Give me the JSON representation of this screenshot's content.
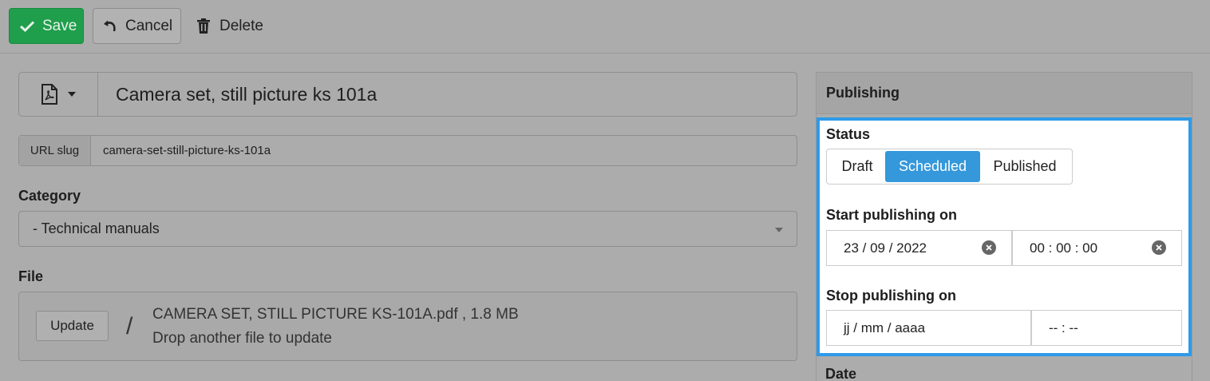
{
  "toolbar": {
    "save_label": "Save",
    "cancel_label": "Cancel",
    "delete_label": "Delete"
  },
  "document": {
    "title": "Camera set, still picture ks 101a",
    "type_icon": "pdf-file-icon"
  },
  "slug": {
    "label": "URL slug",
    "value": "camera-set-still-picture-ks-101a"
  },
  "category": {
    "label": "Category",
    "selected": "- Technical manuals"
  },
  "file": {
    "label": "File",
    "update_label": "Update",
    "separator": "/",
    "name": "CAMERA SET, STILL PICTURE KS-101A.pdf , 1.8 MB",
    "hint": "Drop another file to update"
  },
  "publishing": {
    "header": "Publishing",
    "status_label": "Status",
    "status_options": [
      "Draft",
      "Scheduled",
      "Published"
    ],
    "status_selected": "Scheduled",
    "start_label": "Start publishing on",
    "start_date": "23 / 09 / 2022",
    "start_time": "00 : 00 : 00",
    "stop_label": "Stop publishing on",
    "stop_date": "jj / mm / aaaa",
    "stop_time": "-- : --",
    "date_label": "Date"
  },
  "colors": {
    "save": "#1f9e4c",
    "accent": "#3498db",
    "highlight_border": "#2e9ae8"
  }
}
